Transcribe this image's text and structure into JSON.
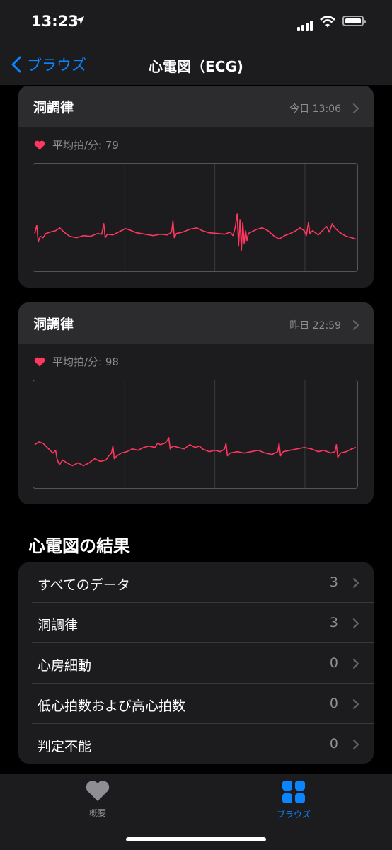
{
  "status": {
    "time": "13:23"
  },
  "nav": {
    "back_label": "ブラウズ",
    "title": "心電図（ECG)"
  },
  "recordings": [
    {
      "classification": "洞調律",
      "date": "今日 13:06",
      "avg_bpm_label": "平均拍/分: 79"
    },
    {
      "classification": "洞調律",
      "date": "昨日 22:59",
      "avg_bpm_label": "平均拍/分: 98"
    }
  ],
  "results": {
    "title": "心電図の結果",
    "rows": [
      {
        "label": "すべてのデータ",
        "count": "3"
      },
      {
        "label": "洞調律",
        "count": "3"
      },
      {
        "label": "心房細動",
        "count": "0"
      },
      {
        "label": "低心拍数および高心拍数",
        "count": "0"
      },
      {
        "label": "判定不能",
        "count": "0"
      }
    ]
  },
  "tabs": [
    {
      "label": "概要",
      "icon": "heart-icon",
      "active": false
    },
    {
      "label": "ブラウズ",
      "icon": "grid-icon",
      "active": true
    }
  ],
  "colors": {
    "accent": "#0a84ff",
    "ecg": "#ff375f",
    "heart": "#ff375f"
  }
}
